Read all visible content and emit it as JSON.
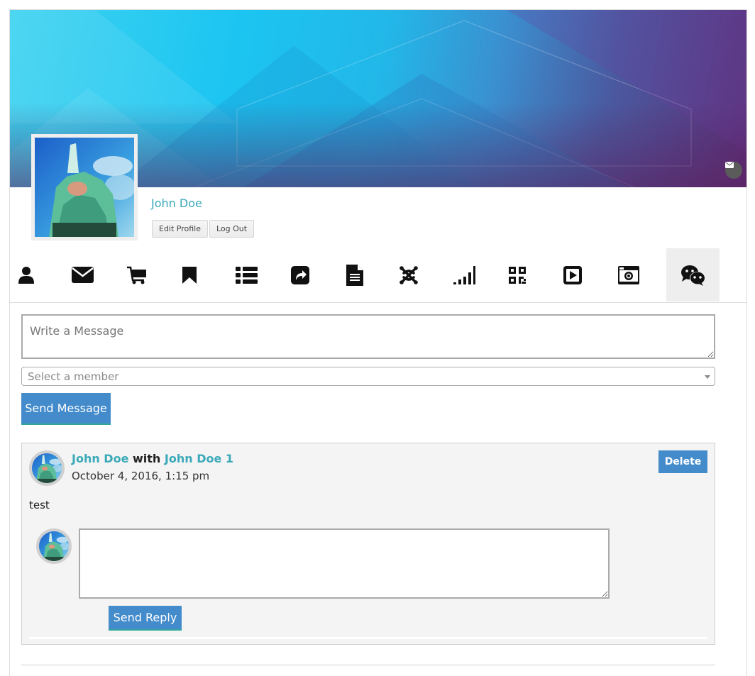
{
  "profile": {
    "name": "John Doe",
    "edit_label": "Edit Profile",
    "logout_label": "Log Out",
    "cover_message_icon": "envelope-icon"
  },
  "tabs": [
    {
      "icon": "user-icon",
      "active": false
    },
    {
      "icon": "envelope-icon",
      "active": false
    },
    {
      "icon": "shopping-cart-icon",
      "active": false
    },
    {
      "icon": "bookmark-icon",
      "active": false
    },
    {
      "icon": "list-icon",
      "active": false
    },
    {
      "icon": "share-square-icon",
      "active": false
    },
    {
      "icon": "file-text-icon",
      "active": false
    },
    {
      "icon": "joomla-icon",
      "active": false
    },
    {
      "icon": "signal-icon",
      "active": false
    },
    {
      "icon": "qrcode-icon",
      "active": false
    },
    {
      "icon": "play-square-icon",
      "active": false
    },
    {
      "icon": "camera-icon",
      "active": false
    },
    {
      "icon": "wechat-icon",
      "active": true
    }
  ],
  "compose": {
    "message_placeholder": "Write a Message",
    "member_placeholder": "Select a member",
    "send_label": "Send Message"
  },
  "thread": {
    "from": "John Doe",
    "with_label": "with",
    "to": "John Doe 1",
    "date": "October 4, 2016, 1:15 pm",
    "delete_label": "Delete",
    "body": "test",
    "reply_value": "",
    "reply_label": "Send Reply"
  },
  "colors": {
    "accent_link": "#3aa9b8",
    "button_blue": "#438bcb",
    "active_tab_bg": "#eeeeee"
  }
}
